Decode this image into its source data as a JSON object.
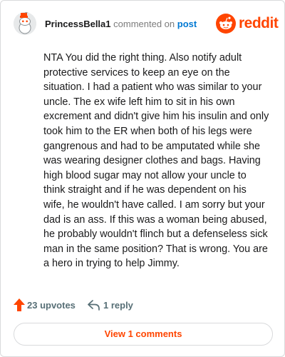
{
  "header": {
    "username": "PrincessBella1",
    "verb": "commented on",
    "post_link": "post",
    "brand_name": "reddit",
    "avatar_icon": "snoo-avatar-icon",
    "brand_icon": "reddit-logo-icon"
  },
  "comment": {
    "body": "NTA You did the right thing. Also notify adult protective services to keep an eye on the situation. I had a patient who was similar to your uncle. The ex wife left him to sit in his own excrement and didn't give him his insulin and only took him to the ER when both of his legs were gangrenous and had to be amputated while she was wearing designer clothes and bags. Having high blood sugar may not allow your uncle to think straight and if he was dependent on his wife, he wouldn't have called. I am sorry but your dad is an ass. If this was a woman being abused, he probably wouldn't flinch but a defenseless sick man in the same position? That is wrong. You are a hero in trying to help Jimmy."
  },
  "actions": {
    "upvotes_label": "23 upvotes",
    "replies_label": "1 reply",
    "upvote_icon": "upvote-arrow-icon",
    "reply_icon": "reply-arrow-icon"
  },
  "footer": {
    "view_comments_label": "View 1 comments"
  },
  "colors": {
    "accent": "#ff4500",
    "link": "#0079d3",
    "muted": "#576f76",
    "border": "#d9dadc"
  }
}
